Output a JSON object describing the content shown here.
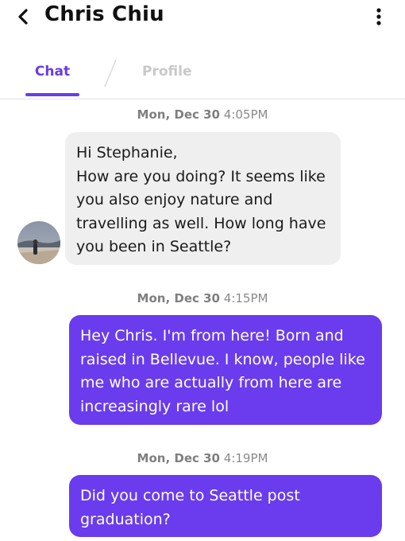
{
  "header": {
    "back_icon": "chevron-left-icon",
    "title": "Chris Chiu",
    "menu_icon": "more-vertical-icon"
  },
  "tabs": [
    {
      "label": "Chat",
      "active": true
    },
    {
      "label": "Profile",
      "active": false
    }
  ],
  "colors": {
    "accent": "#6a3ced",
    "incoming_bubble": "#efefef",
    "inactive_tab": "#c9c9c9"
  },
  "messages": [
    {
      "date": "Mon, Dec 30",
      "time": "4:05PM",
      "direction": "incoming",
      "text": "Hi Stephanie,\nHow are you doing? It seems like you also enjoy nature and travelling as well. How long have you been in Seattle?"
    },
    {
      "date": "Mon, Dec 30",
      "time": "4:15PM",
      "direction": "outgoing",
      "text": "Hey Chris. I'm from here! Born and raised in Bellevue. I know, people like me who are actually from here are increasingly rare lol"
    },
    {
      "date": "Mon, Dec 30",
      "time": "4:19PM",
      "direction": "outgoing",
      "text": "Did you come to Seattle post graduation?"
    }
  ]
}
